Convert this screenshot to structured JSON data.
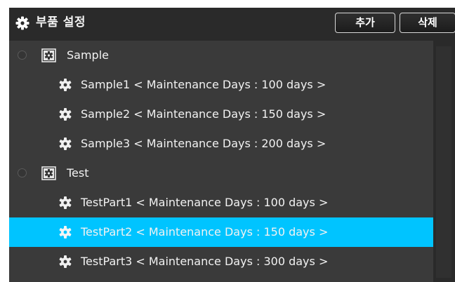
{
  "header": {
    "title": "부품 설정",
    "add_label": "추가",
    "delete_label": "삭제"
  },
  "tree": [
    {
      "name": "Sample",
      "children": [
        {
          "label": "Sample1 < Maintenance Days : 100 days >"
        },
        {
          "label": "Sample2 < Maintenance Days : 150 days >"
        },
        {
          "label": "Sample3 < Maintenance Days : 200 days >"
        }
      ]
    },
    {
      "name": "Test",
      "children": [
        {
          "label": "TestPart1 < Maintenance Days : 100 days >"
        },
        {
          "label": "TestPart2 < Maintenance Days : 150 days >",
          "selected": true
        },
        {
          "label": "TestPart3 < Maintenance Days : 300 days >"
        }
      ]
    }
  ],
  "colors": {
    "selection": "#00c4ff",
    "panel": "#3a3a3a",
    "header": "#2a2a2a"
  }
}
